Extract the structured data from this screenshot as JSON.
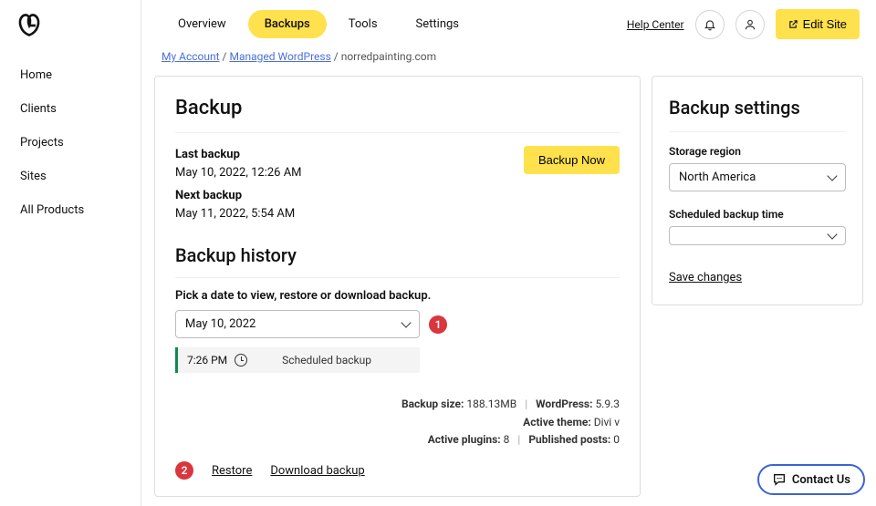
{
  "sidebar": {
    "items": [
      {
        "label": "Home"
      },
      {
        "label": "Clients"
      },
      {
        "label": "Projects"
      },
      {
        "label": "Sites"
      },
      {
        "label": "All Products"
      }
    ]
  },
  "topbar": {
    "tabs": [
      {
        "label": "Overview"
      },
      {
        "label": "Backups"
      },
      {
        "label": "Tools"
      },
      {
        "label": "Settings"
      }
    ],
    "help_label": "Help Center",
    "edit_site_label": "Edit Site"
  },
  "breadcrumb": {
    "account": "My Account",
    "managed": "Managed WordPress",
    "site": "norredpainting.com",
    "sep": " / "
  },
  "backup": {
    "title": "Backup",
    "last_label": "Last backup",
    "last_value": "May 10, 2022, 12:26 AM",
    "next_label": "Next backup",
    "next_value": "May 11, 2022, 5:54 AM",
    "now_label": "Backup Now",
    "history_title": "Backup history",
    "pick_label": "Pick a date to view, restore or download backup.",
    "date_value": "May 10, 2022",
    "row_time": "7:26 PM",
    "row_type": "Scheduled backup",
    "badge1": "1",
    "badge2": "2",
    "meta": {
      "size_label": "Backup size:",
      "size_value": "188.13MB",
      "wp_label": "WordPress:",
      "wp_value": "5.9.3",
      "theme_label": "Active theme:",
      "theme_value": "Divi v",
      "plugins_label": "Active plugins:",
      "plugins_value": "8",
      "posts_label": "Published posts:",
      "posts_value": "0"
    },
    "restore_label": "Restore",
    "download_label": "Download backup"
  },
  "settings": {
    "title": "Backup settings",
    "region_label": "Storage region",
    "region_value": "North America",
    "time_label": "Scheduled backup time",
    "time_value": "",
    "save_label": "Save changes"
  },
  "contact": {
    "label": "Contact Us"
  }
}
